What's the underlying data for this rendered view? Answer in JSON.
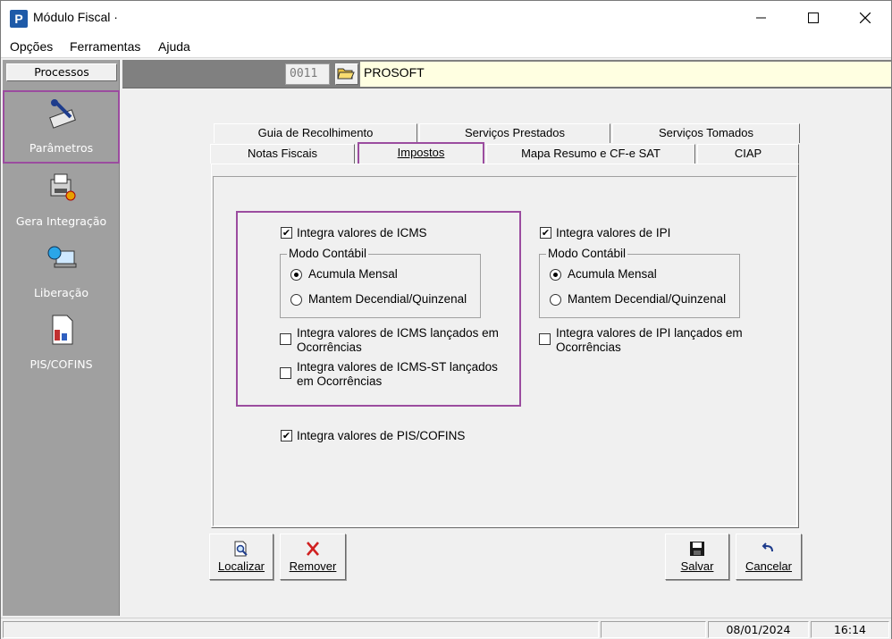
{
  "window": {
    "title": "Módulo Fiscal ·"
  },
  "menu": {
    "items": [
      "Opções",
      "Ferramentas",
      "Ajuda"
    ]
  },
  "sidebar": {
    "header": "Processos",
    "items": [
      {
        "label": "Parâmetros",
        "icon": "parameters-icon"
      },
      {
        "label": "Gera Integração",
        "icon": "integration-icon"
      },
      {
        "label": "Liberação",
        "icon": "release-icon"
      },
      {
        "label": "PIS/COFINS",
        "icon": "pis-cofins-icon"
      }
    ]
  },
  "header": {
    "code": "0011",
    "company": "PROSOFT"
  },
  "tabs": {
    "row1": [
      "Guia de Recolhimento",
      "Serviços Prestados",
      "Serviços Tomados"
    ],
    "row2": [
      "Notas Fiscais",
      "Impostos",
      "Mapa Resumo e CF-e SAT",
      "CIAP"
    ],
    "active": "Impostos"
  },
  "icms": {
    "integra_label": "Integra valores de ICMS",
    "integra_checked": true,
    "modo_title": "Modo Contábil",
    "opt1": "Acumula Mensal",
    "opt2": "Mantem Decendial/Quinzenal",
    "selected": "Acumula Mensal",
    "ocorr_line1": "Integra valores de ICMS lançados em",
    "ocorr_line2": "Ocorrências",
    "st_line1": "Integra valores de ICMS-ST lançados",
    "st_line2": "em Ocorrências"
  },
  "ipi": {
    "integra_label": "Integra valores de IPI",
    "integra_checked": true,
    "modo_title": "Modo Contábil",
    "opt1": "Acumula Mensal",
    "opt2": "Mantem Decendial/Quinzenal",
    "selected": "Acumula Mensal",
    "ocorr_line1": "Integra valores de IPI lançados em",
    "ocorr_line2": "Ocorrências"
  },
  "pis_cofins": {
    "label": "Integra valores de PIS/COFINS",
    "checked": true
  },
  "buttons": {
    "localizar": "Localizar",
    "remover": "Remover",
    "salvar": "Salvar",
    "cancelar": "Cancelar"
  },
  "status": {
    "date": "08/01/2024",
    "time": "16:14"
  },
  "colors": {
    "highlight": "#9b4c9f",
    "sidebar": "#a0a0a0",
    "company_bg": "#ffffe1"
  }
}
